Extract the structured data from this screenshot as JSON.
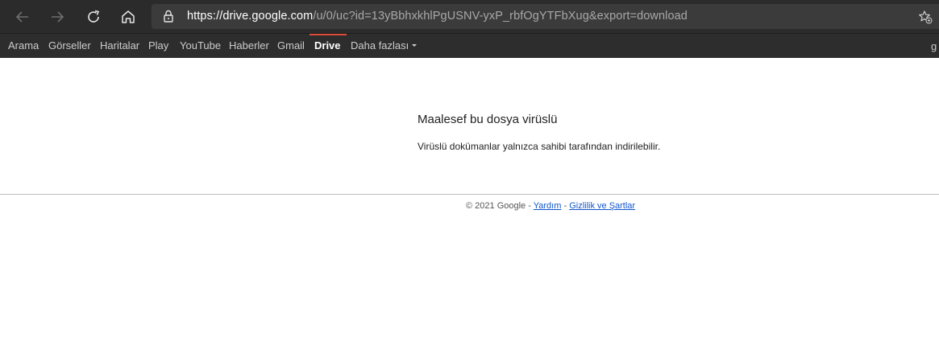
{
  "browser": {
    "url_host": "https://drive.google.com",
    "url_path": "/u/0/uc?id=13yBbhxkhlPgUSNV-yxP_rbfOgYTFbXug&export=download"
  },
  "google_bar": {
    "items": [
      {
        "label": "Arama"
      },
      {
        "label": "Görseller"
      },
      {
        "label": "Haritalar"
      },
      {
        "label": "Play"
      },
      {
        "label": "YouTube"
      },
      {
        "label": "Haberler"
      },
      {
        "label": "Gmail"
      },
      {
        "label": "Drive",
        "active": true
      },
      {
        "label": "Daha fazlası"
      }
    ],
    "right_partial": "g"
  },
  "error": {
    "title": "Maalesef bu dosya virüslü",
    "message": "Virüslü dokümanlar yalnızca sahibi tarafından indirilebilir."
  },
  "footer": {
    "copyright": "© 2021 Google -",
    "help": "Yardım",
    "separator": "-",
    "privacy": "Gizlilik ve Şartlar"
  },
  "colors": {
    "toolbar_bg": "#2b2b2b",
    "google_bar_bg": "#2d2d2d",
    "active_accent": "#dd4b39",
    "link": "#1155cc"
  }
}
